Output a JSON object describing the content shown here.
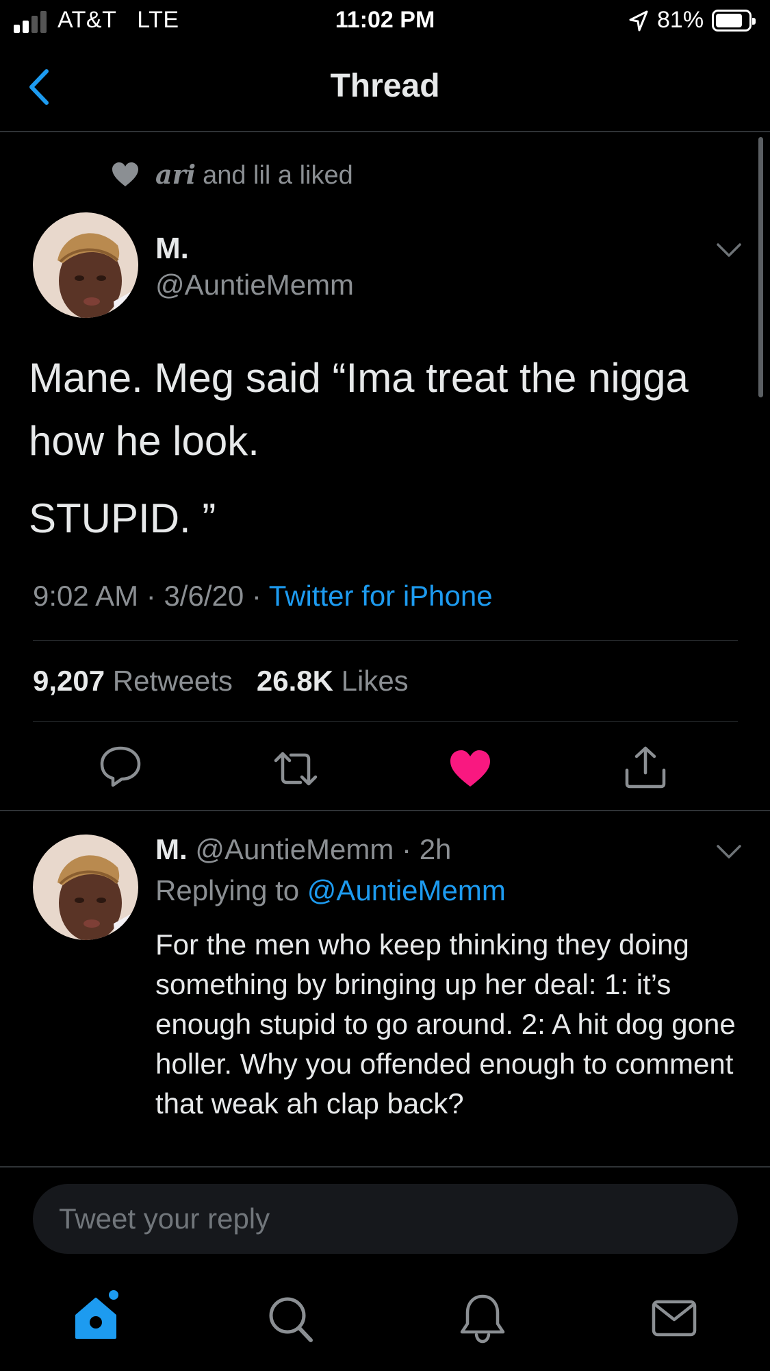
{
  "status_bar": {
    "carrier": "AT&T",
    "network": "LTE",
    "time": "11:02 PM",
    "battery": "81%",
    "battery_level": 0.81
  },
  "nav": {
    "title": "Thread"
  },
  "liked_by": {
    "name": "ari",
    "rest": "and lil a liked"
  },
  "tweet": {
    "display_name": "M.",
    "handle": "@AuntieMemm",
    "text_line1": "Mane. Meg said “Ima treat the nigga how he look.",
    "text_line2": "STUPID. ”",
    "time": "9:02 AM",
    "date": "3/6/20",
    "source": "Twitter for iPhone",
    "retweets_count": "9,207",
    "retweets_label": "Retweets",
    "likes_count": "26.8K",
    "likes_label": "Likes"
  },
  "reply": {
    "display_name": "M.",
    "handle": "@AuntieMemm",
    "age": "2h",
    "replying_to_label": "Replying to",
    "replying_to": "@AuntieMemm",
    "text": "For the men who keep thinking they doing something by bringing up her deal: 1: it’s enough stupid to go around. 2: A hit dog gone holler. Why you offended enough to comment that weak ah clap back?"
  },
  "compose": {
    "placeholder": "Tweet your reply"
  },
  "colors": {
    "accent": "#1d9bf0",
    "like": "#f91880",
    "background": "#000000",
    "secondary_text": "#8b8f93"
  },
  "icons": {
    "tab_bar": [
      "home-icon",
      "search-icon",
      "notifications-icon",
      "messages-icon"
    ],
    "actions": [
      "reply-icon",
      "retweet-icon",
      "like-icon",
      "share-icon"
    ]
  }
}
